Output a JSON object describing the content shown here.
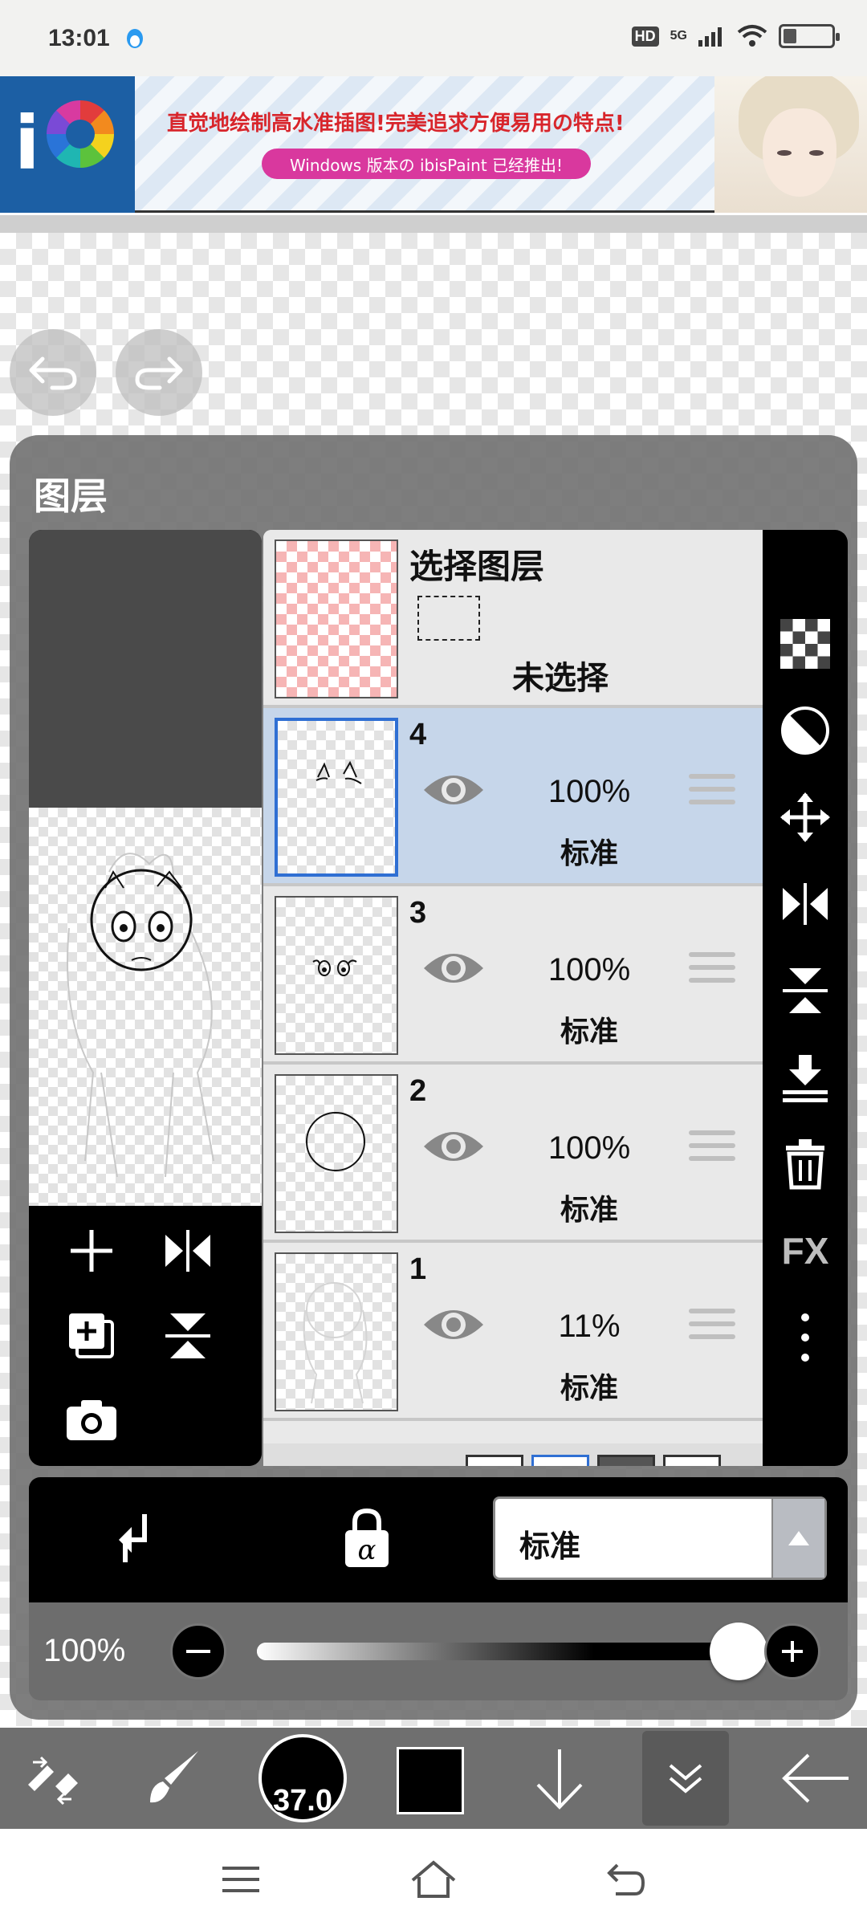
{
  "status_bar": {
    "time": "13:01",
    "hd": "HD",
    "network": "5G"
  },
  "banner": {
    "headline": "直觉地绘制高水准插图!完美追求方便易用の特点!",
    "pill_text": "Windows 版本の ibisPaint 已经推出!",
    "brand_color": "#1c5fa4",
    "pill_color": "#d9389e"
  },
  "layer_panel": {
    "title": "图层",
    "selection_layer": {
      "title": "选择图层",
      "status": "未选择"
    },
    "layers": [
      {
        "number": "4",
        "opacity": "100%",
        "blend": "标准",
        "selected": true
      },
      {
        "number": "3",
        "opacity": "100%",
        "blend": "标准",
        "selected": false
      },
      {
        "number": "2",
        "opacity": "100%",
        "blend": "标准",
        "selected": false
      },
      {
        "number": "1",
        "opacity": "11%",
        "blend": "标准",
        "selected": false
      }
    ],
    "right_tools": {
      "fx_label": "FX"
    },
    "blend_mode": {
      "selected": "标准"
    },
    "opacity": {
      "label": "100%",
      "value": 1.0
    }
  },
  "toolbar": {
    "brush_size": "37.0",
    "color": "#000000"
  },
  "icons": {
    "undo": "undo-icon",
    "redo": "redo-icon",
    "add_layer": "plus-icon",
    "flip_horizontal": "flip-horizontal-icon",
    "duplicate_layer": "duplicate-icon",
    "flip_vertical": "flip-vertical-icon",
    "camera": "camera-icon",
    "eye": "eye-icon",
    "checker_fill": "checker-icon",
    "invert": "invert-icon",
    "move": "move-icon",
    "merge_down": "merge-down-icon",
    "delete": "trash-icon",
    "more": "more-vertical-icon",
    "clip": "clip-arrow-icon",
    "alpha_lock": "alpha-lock-icon",
    "brush_tools": "tool-switch-icon",
    "brush": "brush-icon",
    "down_arrow": "arrow-down-icon",
    "collapse": "double-chevron-down-icon",
    "back": "arrow-left-icon"
  }
}
